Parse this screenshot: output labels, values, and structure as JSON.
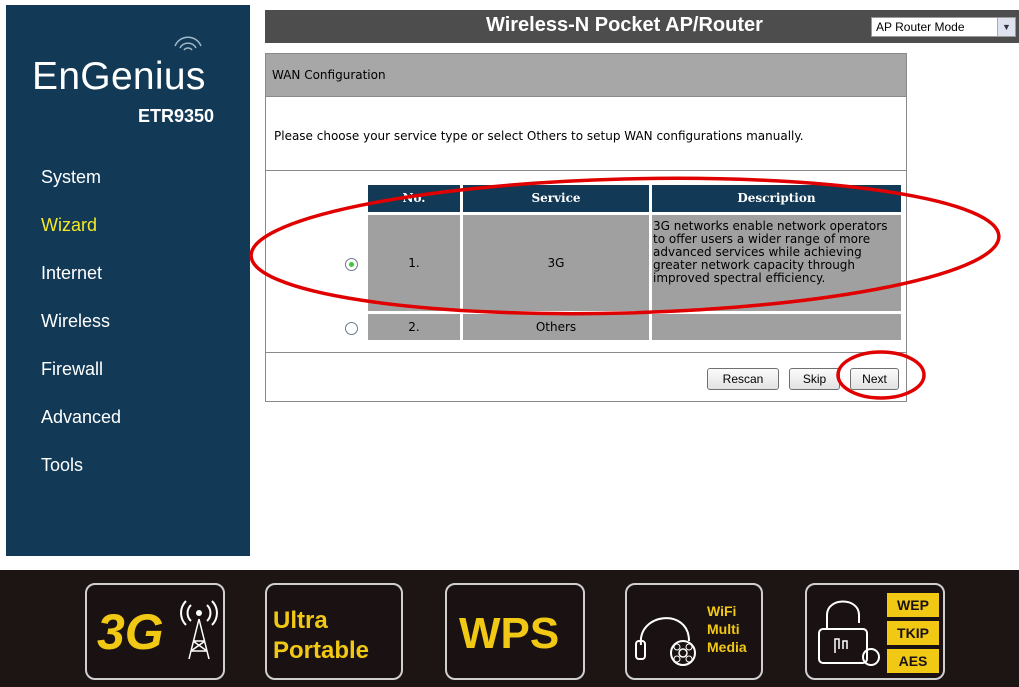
{
  "brand": {
    "logo": "EnGenius",
    "model": "ETR9350"
  },
  "sidebar": {
    "items": [
      {
        "label": "System"
      },
      {
        "label": "Wizard",
        "active": true
      },
      {
        "label": "Internet"
      },
      {
        "label": "Wireless"
      },
      {
        "label": "Firewall"
      },
      {
        "label": "Advanced"
      },
      {
        "label": "Tools"
      }
    ]
  },
  "header": {
    "title": "Wireless-N Pocket AP/Router",
    "mode_select": "AP Router Mode"
  },
  "wan": {
    "title": "WAN Configuration",
    "instruction": "Please choose your service type or select Others to setup WAN configurations manually.",
    "columns": [
      "No.",
      "Service",
      "Description"
    ],
    "rows": [
      {
        "no": "1.",
        "service": "3G",
        "description": "3G networks enable network operators to offer users a wider range of more advanced services while achieving greater network capacity through improved spectral efficiency.",
        "selected": true
      },
      {
        "no": "2.",
        "service": "Others",
        "description": "",
        "selected": false
      }
    ]
  },
  "buttons": {
    "rescan": "Rescan",
    "skip": "Skip",
    "next": "Next"
  },
  "footer": {
    "badges": [
      {
        "name": "3g",
        "text": "3G"
      },
      {
        "name": "ultra-portable",
        "line1": "Ultra",
        "line2": "Portable"
      },
      {
        "name": "wps",
        "text": "WPS"
      },
      {
        "name": "wifi-multi-media",
        "line1": "WiFi",
        "line2": "Multi",
        "line3": "Media"
      },
      {
        "name": "security",
        "line1": "WEP",
        "line2": "TKIP",
        "line3": "AES"
      }
    ]
  },
  "colors": {
    "sidebar": "#123a56",
    "active_nav": "#f4e829",
    "footer_text": "#f1c814",
    "annotation": "#e00000",
    "radio_selected": "#3ec83e"
  }
}
